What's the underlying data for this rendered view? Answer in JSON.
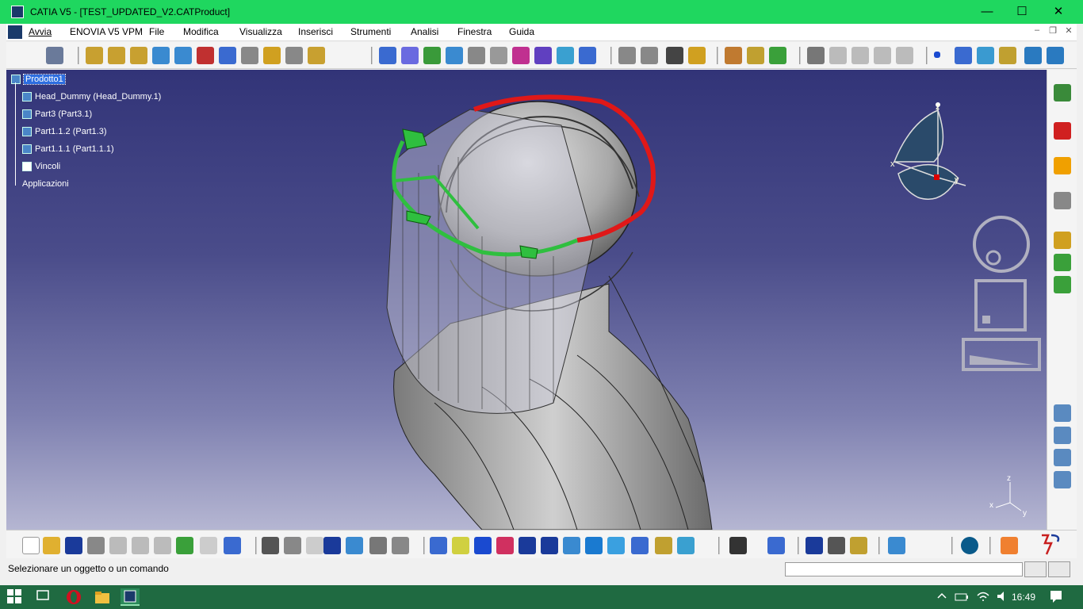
{
  "window": {
    "title": "CATIA V5 - [TEST_UPDATED_V2.CATProduct]"
  },
  "menu": {
    "items": [
      "Avvia",
      "ENOVIA V5 VPM",
      "File",
      "Modifica",
      "Visualizza",
      "Inserisci",
      "Strumenti",
      "Analisi",
      "Finestra",
      "Guida"
    ]
  },
  "tree": {
    "root": "Prodotto1",
    "children": [
      "Head_Dummy (Head_Dummy.1)",
      "Part3 (Part3.1)",
      "Part1.1.2 (Part1.3)",
      "Part1.1.1 (Part1.1.1)",
      "Vincoli",
      "Applicazioni"
    ]
  },
  "compass": {
    "x_label": "x",
    "y_label": "y",
    "z_label": "z"
  },
  "axis_triad": {
    "x_label": "x",
    "y_label": "y",
    "z_label": "z"
  },
  "status": {
    "message": "Selezionare un oggetto o un comando"
  },
  "taskbar": {
    "clock": "16:49"
  },
  "colors": {
    "title_bar": "#1fd75f",
    "viewport_top": "#323478",
    "viewport_bottom": "#b5b6d2",
    "visor_frame": "#2fbf3f",
    "headband_red": "#e01818"
  }
}
